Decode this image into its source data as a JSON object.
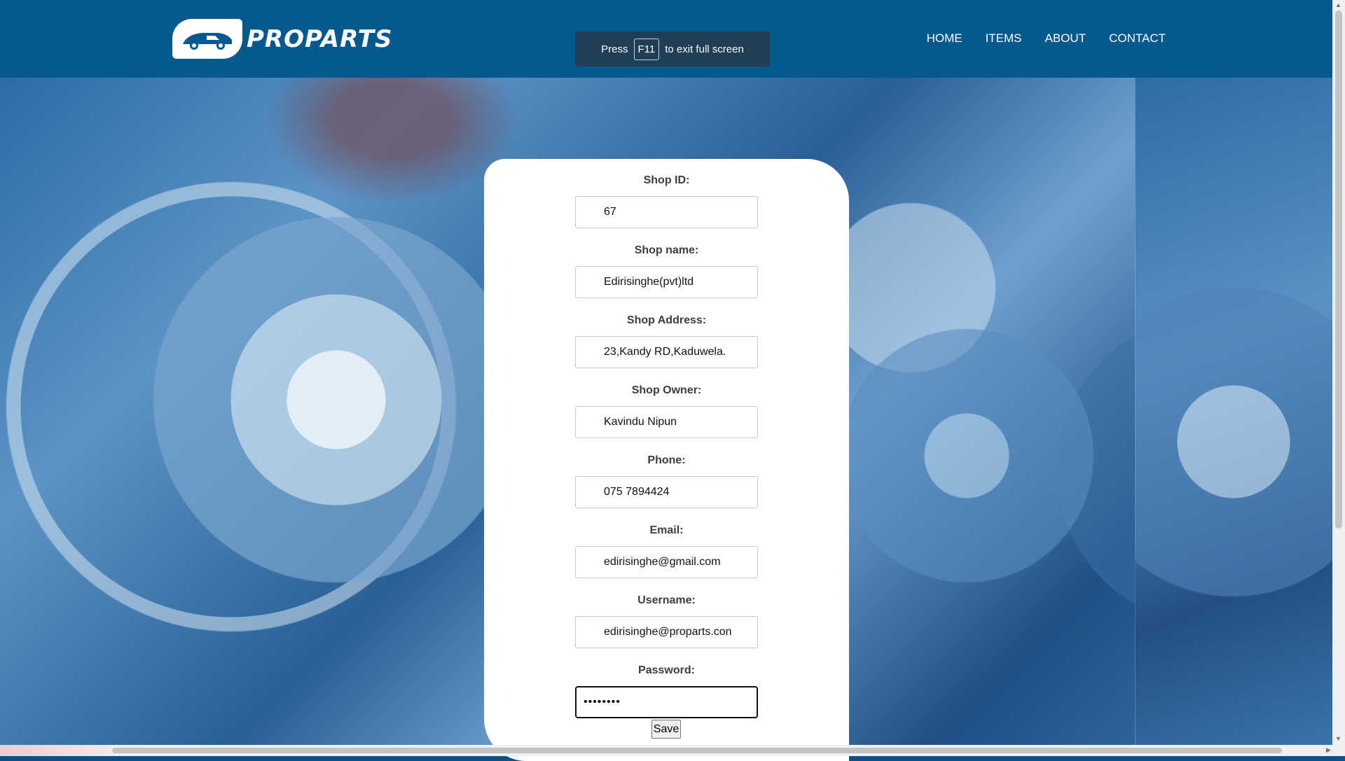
{
  "brand": {
    "name": "PROPARTS",
    "logo_icon": "car-icon"
  },
  "nav": {
    "items": [
      "HOME",
      "ITEMS",
      "ABOUT",
      "CONTACT"
    ]
  },
  "fullscreen_notice": {
    "before": "Press",
    "key": "F11",
    "after": "to exit full screen"
  },
  "form": {
    "fields": [
      {
        "label": "Shop ID:",
        "value": "67"
      },
      {
        "label": "Shop name:",
        "value": "Edirisinghe(pvt)ltd"
      },
      {
        "label": "Shop Address:",
        "value": "23,Kandy RD,Kaduwela."
      },
      {
        "label": "Shop Owner:",
        "value": "Kavindu Nipun"
      },
      {
        "label": "Phone:",
        "value": "075 7894424"
      },
      {
        "label": "Email:",
        "value": "edirisinghe@gmail.com"
      },
      {
        "label": "Username:",
        "value": "edirisinghe@proparts.con"
      },
      {
        "label": "Password:",
        "value": "••••••••"
      }
    ],
    "save_label": "Save"
  },
  "colors": {
    "header": "#06598f",
    "card": "#ffffff",
    "text": "#3d3d3d"
  }
}
